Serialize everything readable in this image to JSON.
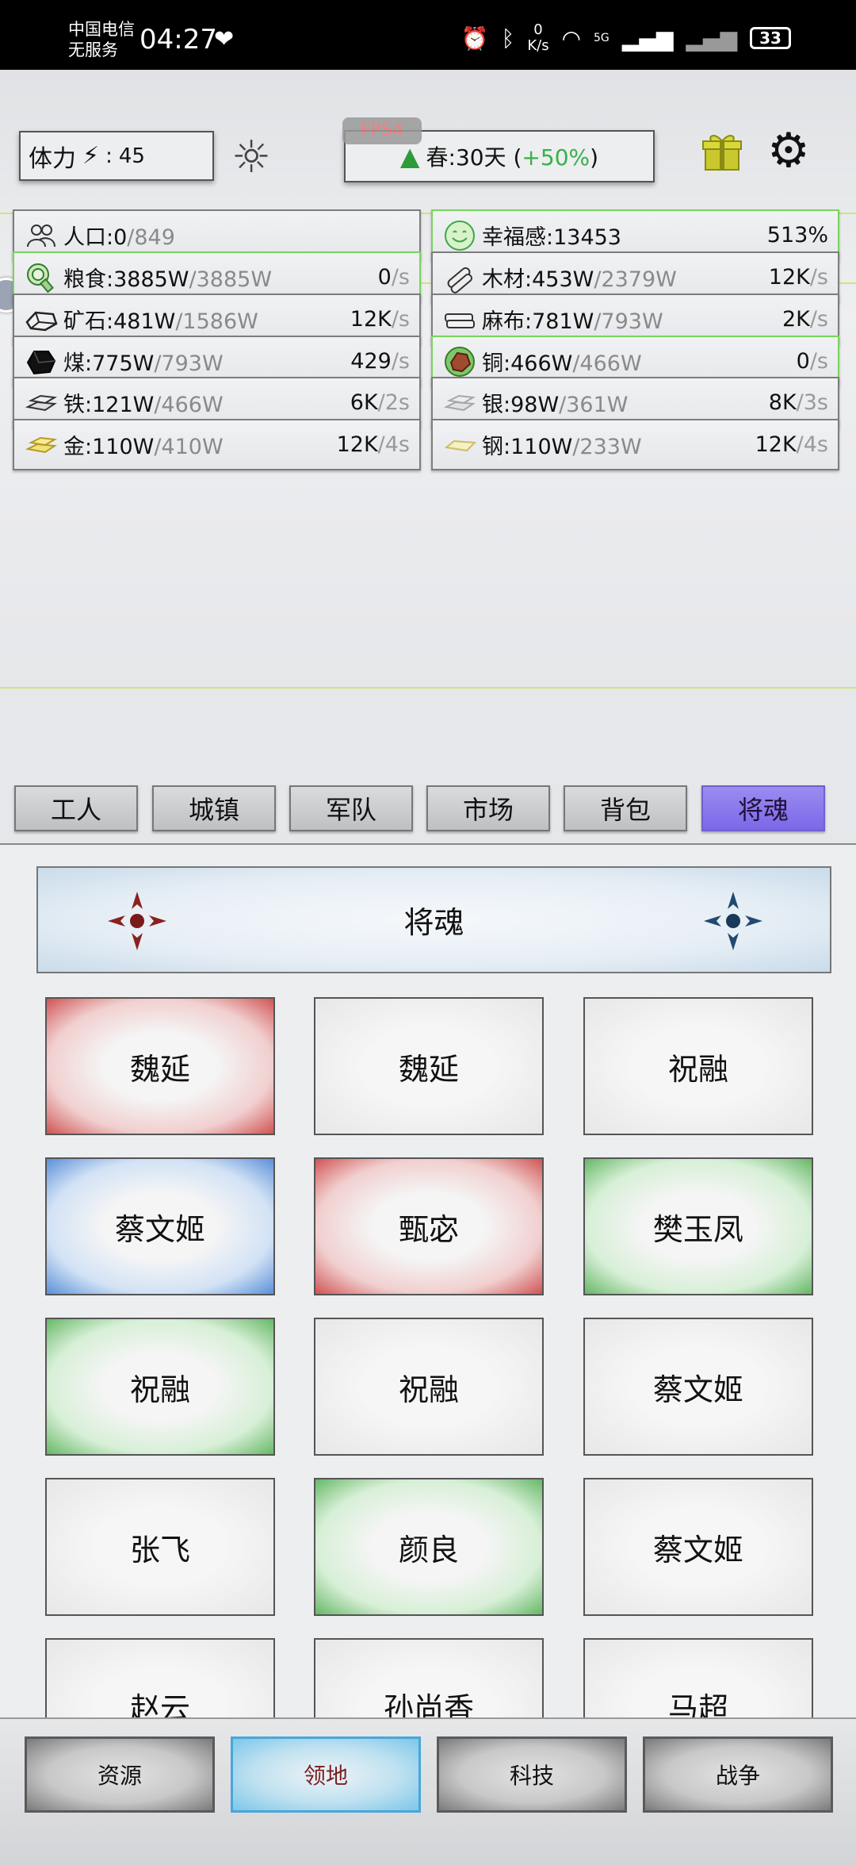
{
  "status_bar": {
    "carrier_line1": "中国电信",
    "carrier_line2": "无服务",
    "time": "04:27",
    "speed_value": "0",
    "speed_unit": "K/s",
    "network": "5G",
    "battery": "33"
  },
  "header": {
    "stamina_label": "体力",
    "stamina_separator": ":",
    "stamina_value": "45",
    "fps": "FPS4",
    "season_text": "春:30天 (",
    "season_bonus": "+50%",
    "season_close": ")"
  },
  "resources": [
    {
      "name": "人口:0",
      "max": "/849",
      "rate": "",
      "unit": "",
      "icon": "people-icon",
      "highlight": false
    },
    {
      "name": "幸福感:13453",
      "max": "",
      "rate": "513%",
      "unit": "",
      "icon": "smile-icon",
      "highlight": true
    },
    {
      "name": "粮食:3885W",
      "max": "/3885W",
      "rate": "0",
      "unit": "/s",
      "icon": "food-icon",
      "highlight": true
    },
    {
      "name": "木材:453W",
      "max": "/2379W",
      "rate": "12K",
      "unit": "/s",
      "icon": "wood-icon",
      "highlight": false
    },
    {
      "name": "矿石:481W",
      "max": "/1586W",
      "rate": "12K",
      "unit": "/s",
      "icon": "ore-icon",
      "highlight": false
    },
    {
      "name": "麻布:781W",
      "max": "/793W",
      "rate": "2K",
      "unit": "/s",
      "icon": "cloth-icon",
      "highlight": false
    },
    {
      "name": "煤:775W",
      "max": "/793W",
      "rate": "429",
      "unit": "/s",
      "icon": "coal-icon",
      "highlight": false
    },
    {
      "name": "铜:466W",
      "max": "/466W",
      "rate": "0",
      "unit": "/s",
      "icon": "copper-icon",
      "highlight": true
    },
    {
      "name": "铁:121W",
      "max": "/466W",
      "rate": "6K",
      "unit": "/2s",
      "icon": "iron-icon",
      "highlight": false
    },
    {
      "name": "银:98W",
      "max": "/361W",
      "rate": "8K",
      "unit": "/3s",
      "icon": "silver-icon",
      "highlight": false
    },
    {
      "name": "金:110W",
      "max": "/410W",
      "rate": "12K",
      "unit": "/4s",
      "icon": "gold-icon",
      "highlight": false
    },
    {
      "name": "钢:110W",
      "max": "/233W",
      "rate": "12K",
      "unit": "/4s",
      "icon": "steel-icon",
      "highlight": false
    }
  ],
  "tabs": [
    {
      "label": "工人",
      "active": false
    },
    {
      "label": "城镇",
      "active": false
    },
    {
      "label": "军队",
      "active": false
    },
    {
      "label": "市场",
      "active": false
    },
    {
      "label": "背包",
      "active": false
    },
    {
      "label": "将魂",
      "active": true
    }
  ],
  "banner_title": "将魂",
  "cards": [
    {
      "name": "魏延",
      "tier": "red"
    },
    {
      "name": "魏延",
      "tier": "white"
    },
    {
      "name": "祝融",
      "tier": "white"
    },
    {
      "name": "蔡文姬",
      "tier": "blue"
    },
    {
      "name": "甄宓",
      "tier": "red"
    },
    {
      "name": "樊玉凤",
      "tier": "green"
    },
    {
      "name": "祝融",
      "tier": "green"
    },
    {
      "name": "祝融",
      "tier": "white"
    },
    {
      "name": "蔡文姬",
      "tier": "white"
    },
    {
      "name": "张飞",
      "tier": "white"
    },
    {
      "name": "颜良",
      "tier": "green"
    },
    {
      "name": "蔡文姬",
      "tier": "white"
    },
    {
      "name": "赵云",
      "tier": "white"
    },
    {
      "name": "孙尚香",
      "tier": "white"
    },
    {
      "name": "马超",
      "tier": "white"
    }
  ],
  "bottom_nav": [
    {
      "label": "资源",
      "active": false
    },
    {
      "label": "领地",
      "active": true
    },
    {
      "label": "科技",
      "active": false
    },
    {
      "label": "战争",
      "active": false
    }
  ],
  "colors": {
    "active_tab": "#7b68e8",
    "active_nav": "#7bc7ea",
    "bonus_green": "#38b048",
    "highlight_border": "#79d45d"
  }
}
